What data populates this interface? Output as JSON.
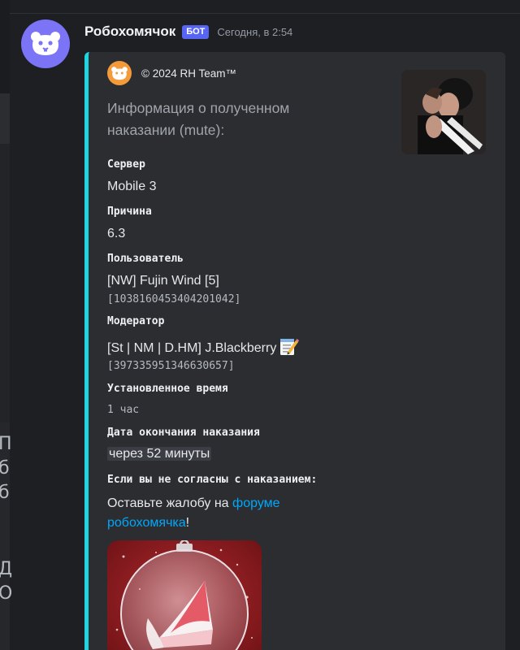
{
  "message": {
    "username": "Робохомячок",
    "badge": "БОТ",
    "timestamp": "Сегодня, в 2:54"
  },
  "embed": {
    "accent_color": "#1fd6e0",
    "author": "© 2024 RH Team™",
    "title": "Информация о полученном наказании (mute):",
    "fields": {
      "server": {
        "name": "Сервер",
        "value": "Mobile 3"
      },
      "reason": {
        "name": "Причина",
        "value": "6.3"
      },
      "user": {
        "name": "Пользователь",
        "value": "[NW] Fujin Wind [5]",
        "id": "[1038160453404201042]"
      },
      "moderator": {
        "name": "Модератор",
        "value": "[St | NM | D.HM] J.Blackberry",
        "icon": "memo-icon",
        "id": "[397335951346630657]"
      },
      "duration": {
        "name": "Установленное время",
        "value": "1 час"
      },
      "end_date": {
        "name": "Дата окончания наказания",
        "value": "через 52 минуты"
      },
      "appeal": {
        "name": "Если вы не согласны с наказанием:",
        "prefix": "Оставьте жалобу на ",
        "link": "форуме робохомячка",
        "suffix": "!"
      }
    }
  },
  "left_rail": {
    "chars": [
      "П",
      "б",
      "б",
      "Д",
      "О"
    ]
  }
}
